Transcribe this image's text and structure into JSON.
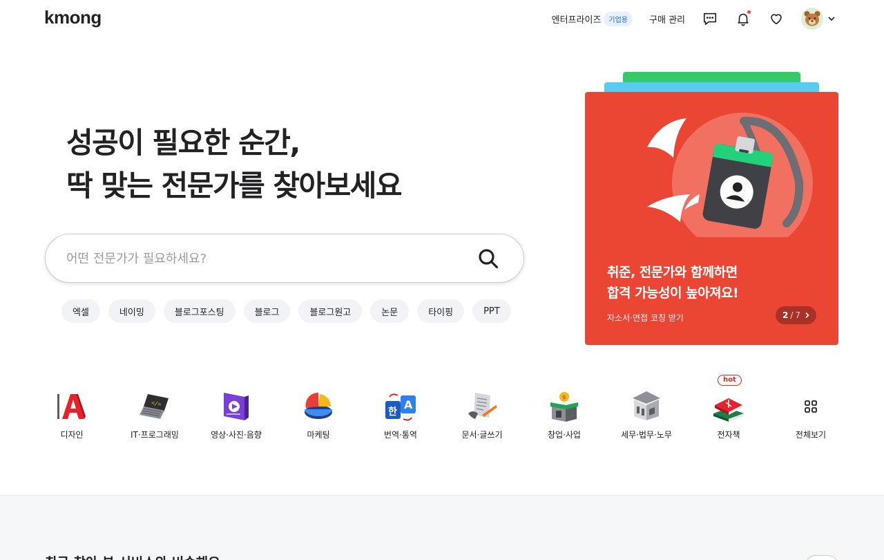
{
  "header": {
    "logo": "kmong",
    "enterprise_label": "엔터프라이즈",
    "enterprise_badge": "기업용",
    "purchase_label": "구매 관리"
  },
  "hero": {
    "title_line1": "성공이 필요한 순간,",
    "title_line2": "딱 맞는 전문가를 찾아보세요"
  },
  "search": {
    "placeholder": "어떤 전문가가 필요하세요?",
    "value": ""
  },
  "chips": [
    "엑셀",
    "네이밍",
    "블로그포스팅",
    "블로그",
    "블로그원고",
    "논문",
    "타이핑",
    "PPT"
  ],
  "banner": {
    "title_line1": "취준, 전문가와 함께하면",
    "title_line2": "합격 가능성이 높아져요!",
    "subtitle": "자소서·면접 코칭 받기",
    "page_current": "2",
    "page_sep": "/",
    "page_total": "7",
    "bg_color": "#eb4534"
  },
  "categories": [
    {
      "label": "디자인",
      "icon": "design-icon"
    },
    {
      "label": "IT·프로그래밍",
      "icon": "laptop-code-icon"
    },
    {
      "label": "영상·사진·음향",
      "icon": "video-icon"
    },
    {
      "label": "마케팅",
      "icon": "pie-chart-icon"
    },
    {
      "label": "번역·통역",
      "icon": "translate-icon"
    },
    {
      "label": "문서·글쓰기",
      "icon": "document-pen-icon"
    },
    {
      "label": "창업·사업",
      "icon": "store-icon"
    },
    {
      "label": "세무·법무·노무",
      "icon": "building-icon"
    },
    {
      "label": "전자책",
      "icon": "books-icon",
      "badge": "hot"
    },
    {
      "label": "전체보기",
      "icon": "grid-icon"
    }
  ],
  "bottom": {
    "section_title": "최근 찾아 본 서비스와 비슷해요"
  },
  "colors": {
    "accent_red": "#eb4534",
    "hot_red": "#e0291a",
    "badge_blue": "#1c6fe6"
  }
}
